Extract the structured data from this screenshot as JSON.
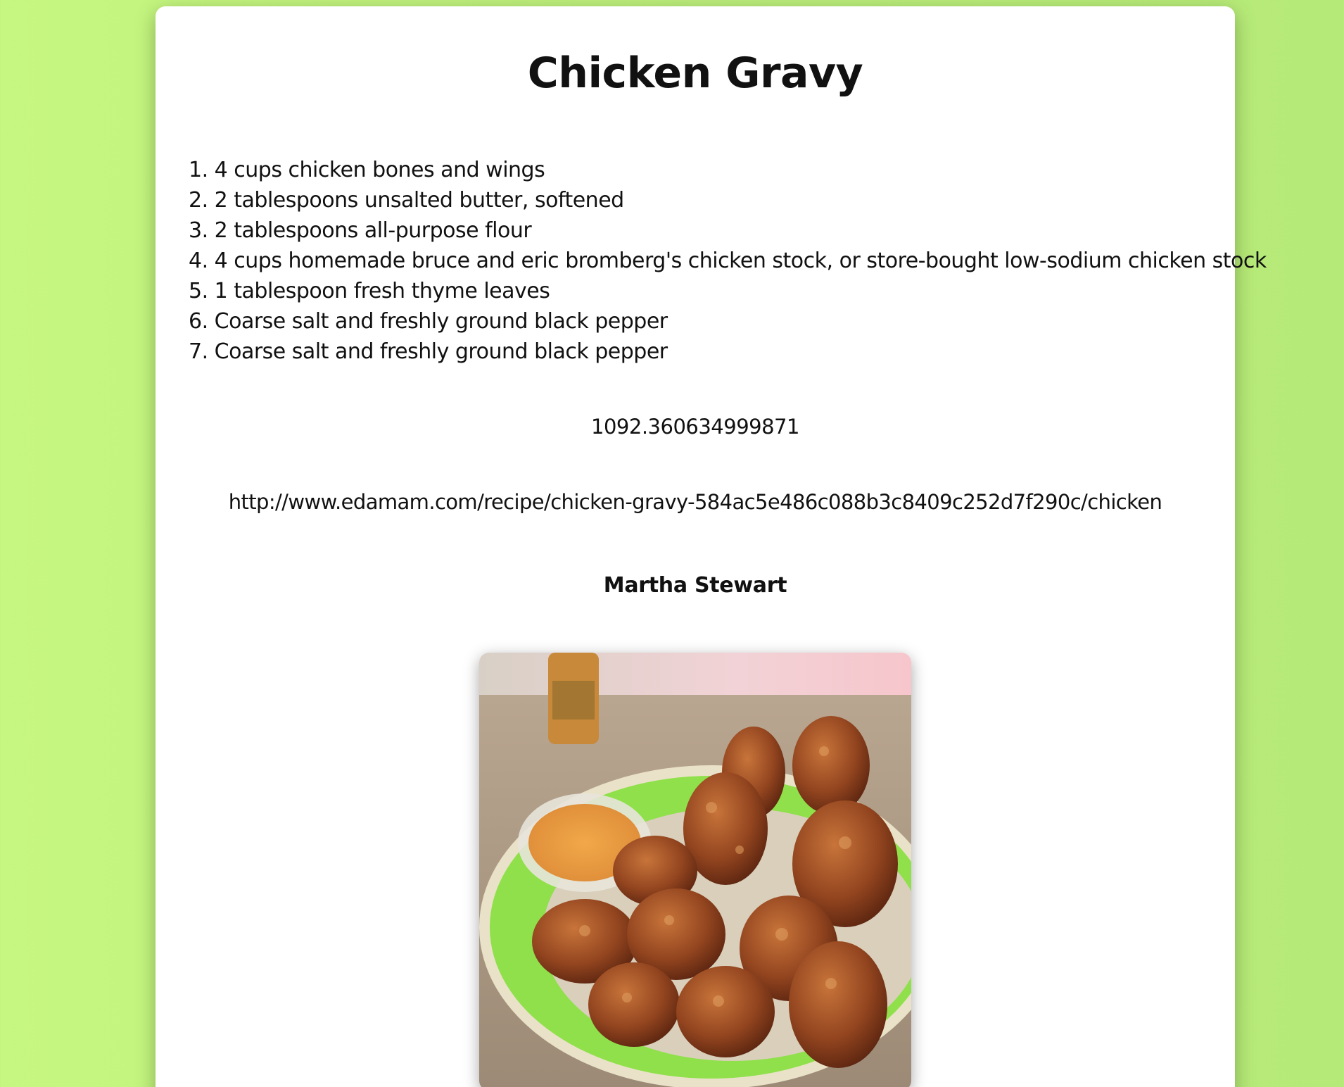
{
  "recipe": {
    "title": "Chicken Gravy",
    "ingredients": [
      "1. 4 cups chicken bones and wings",
      "2. 2 tablespoons unsalted butter, softened",
      "3. 2 tablespoons all-purpose flour",
      "4. 4 cups homemade bruce and eric bromberg's chicken stock, or store-bought low-sodium chicken stock",
      "5. 1 tablespoon fresh thyme leaves",
      "6. Coarse salt and freshly ground black pepper",
      "7. Coarse salt and freshly ground black pepper"
    ],
    "calories": "1092.360634999871",
    "url": "http://www.edamam.com/recipe/chicken-gravy-584ac5e486c088b3c8409c252d7f290c/chicken",
    "source": "Martha Stewart",
    "image_icon": "fried-chicken-photo"
  },
  "colors": {
    "background": "#c6f780",
    "card": "#ffffff",
    "text": "#111111",
    "plate_rim": "#8fe04a"
  }
}
